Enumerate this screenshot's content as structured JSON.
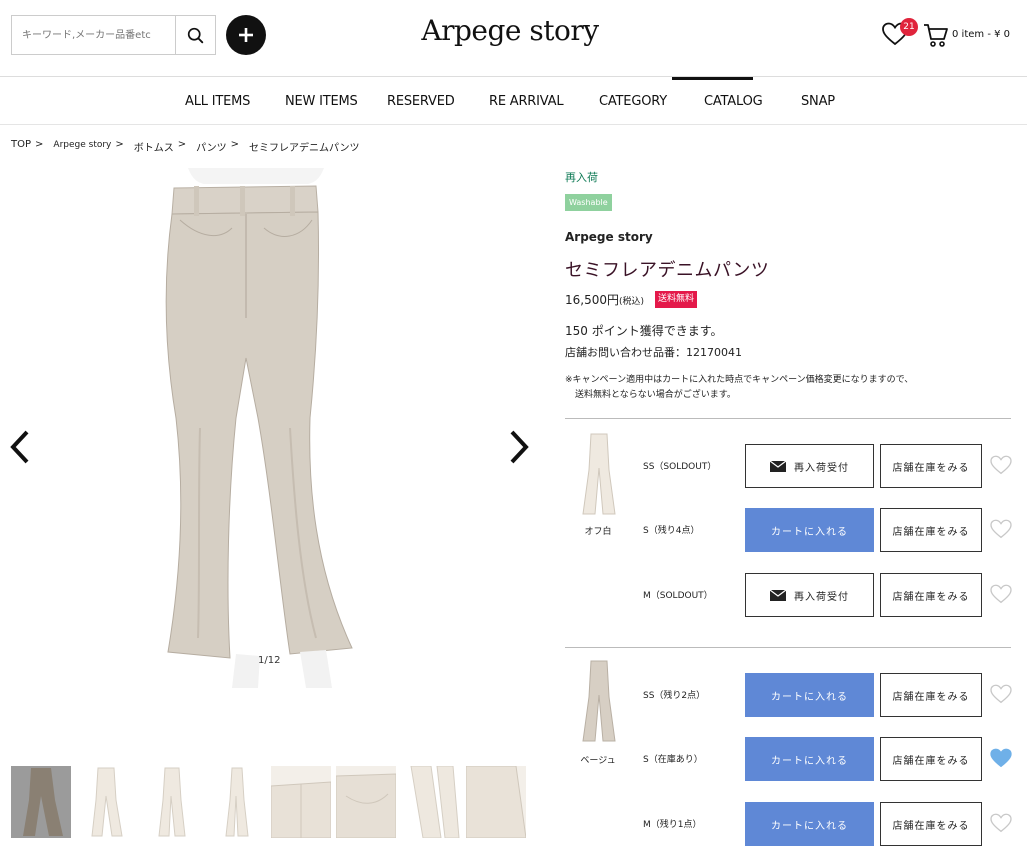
{
  "header": {
    "search_placeholder": "キーワード,メーカー品番etc",
    "logo": "Arpege story",
    "favorites_count": "21",
    "cart_summary": "0 item - ¥ 0"
  },
  "nav": {
    "items": [
      "ALL ITEMS",
      "NEW ITEMS",
      "RESERVED",
      "RE ARRIVAL",
      "CATEGORY",
      "CATALOG",
      "SNAP"
    ],
    "active": "CATALOG"
  },
  "breadcrumb": [
    "TOP",
    ">",
    "Arpege story",
    ">",
    "ボトムス",
    ">",
    "パンツ",
    ">",
    "セミフレアデニムパンツ"
  ],
  "gallery": {
    "counter": "1/12",
    "thumb_count": 8
  },
  "product": {
    "restock_label": "再入荷",
    "washable_tag": "Washable",
    "brand": "Arpege story",
    "title": "セミフレアデニムパンツ",
    "price": "16,500円",
    "tax_note": "(税込)",
    "free_shipping": "送料無料",
    "points": "150 ポイント獲得できます。",
    "store_code": "店舗お問い合わせ品番：12170041",
    "notice_line1": "※キャンペーン適用中はカートに入れた時点でキャンペーン価格変更になりますので、",
    "notice_line2": "送料無料とならない場合がございます。"
  },
  "buttons": {
    "restock": "再入荷受付",
    "add_to_cart": "カートに入れる",
    "store_stock": "店舗在庫をみる"
  },
  "colors": [
    {
      "name": "オフ白",
      "swatch_color": "#efe9e0",
      "sizes": [
        {
          "label": "SS（SOLDOUT）",
          "soldout": true,
          "favorited": false
        },
        {
          "label": "S（残り4点）",
          "soldout": false,
          "favorited": false
        },
        {
          "label": "M（SOLDOUT）",
          "soldout": true,
          "favorited": false
        }
      ]
    },
    {
      "name": "ベージュ",
      "swatch_color": "#d7cfc4",
      "sizes": [
        {
          "label": "SS（残り2点）",
          "soldout": false,
          "favorited": false
        },
        {
          "label": "S（在庫あり）",
          "soldout": false,
          "favorited": true
        },
        {
          "label": "M（残り1点）",
          "soldout": false,
          "favorited": false
        }
      ]
    }
  ],
  "theme": {
    "accent_blue": "#5f88d6",
    "restock_green": "#0e7a55",
    "free_ship_red": "#e4194a",
    "favorited_heart": "#6fb0e8"
  }
}
